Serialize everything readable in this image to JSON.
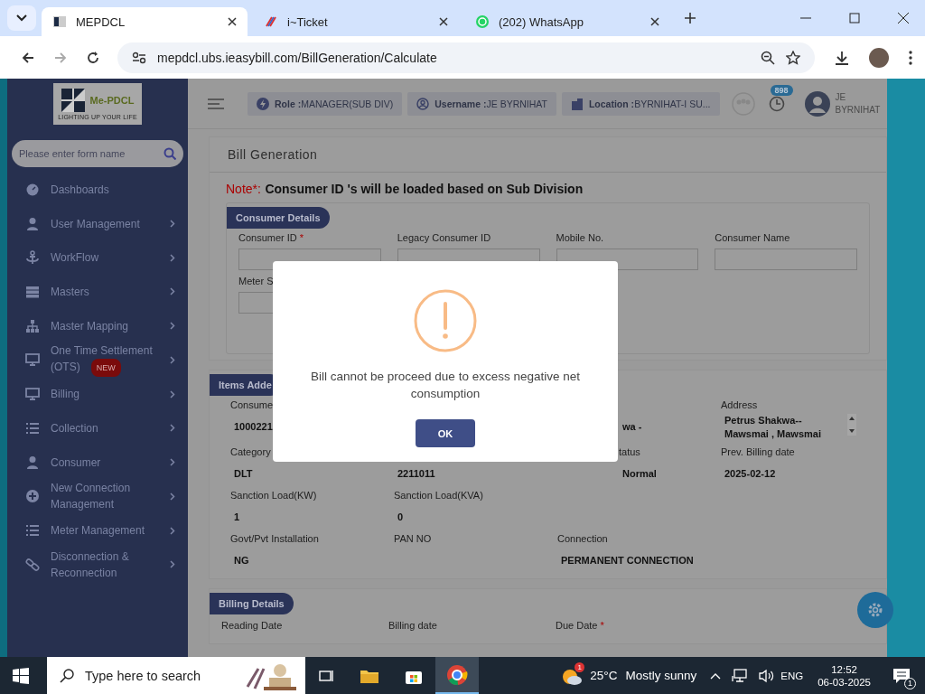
{
  "browser": {
    "tabs": [
      {
        "title": "MEPDCL",
        "selected": true
      },
      {
        "title": "i~Ticket",
        "selected": false
      },
      {
        "title": "(202) WhatsApp",
        "selected": false
      }
    ],
    "url": "mepdcl.ubs.ieasybill.com/BillGeneration/Calculate"
  },
  "sidebar": {
    "logo_text": "Me-PDCL",
    "logo_tagline": "LIGHTING UP YOUR LIFE",
    "search": {
      "placeholder": "Please enter form name"
    },
    "items": [
      {
        "label": "Dashboards",
        "kind": "link"
      },
      {
        "label": "User Management",
        "kind": "submenu"
      },
      {
        "label": "WorkFlow",
        "kind": "submenu"
      },
      {
        "label": "Masters",
        "kind": "submenu"
      },
      {
        "label": "Master Mapping",
        "kind": "submenu"
      },
      {
        "label": "One Time Settlement (OTS)",
        "kind": "submenu",
        "badge": "NEW"
      },
      {
        "label": "Billing",
        "kind": "submenu"
      },
      {
        "label": "Collection",
        "kind": "submenu"
      },
      {
        "label": "Consumer",
        "kind": "submenu"
      },
      {
        "label": "New Connection Management",
        "kind": "submenu"
      },
      {
        "label": "Meter Management",
        "kind": "submenu"
      },
      {
        "label": "Disconnection & Reconnection",
        "kind": "submenu"
      }
    ]
  },
  "header": {
    "chips": [
      {
        "key": "Role :",
        "value": "MANAGER(SUB DIV)"
      },
      {
        "key": "Username :",
        "value": "JE BYRNIHAT"
      },
      {
        "key": "Location :",
        "value": "BYRNIHAT-I SU..."
      }
    ],
    "notification_count": "898",
    "user": "JE BYRNIHAT"
  },
  "page": {
    "title": "Bill Generation",
    "note_label": "Note*:",
    "note_text": "Consumer ID 's will be loaded based on Sub Division",
    "consumer_details": {
      "legend": "Consumer Details",
      "fields": [
        {
          "label": "Consumer ID",
          "required_mark": "*"
        },
        {
          "label": "Legacy Consumer ID"
        },
        {
          "label": "Mobile No."
        },
        {
          "label": "Consumer Name"
        },
        {
          "label": "Meter S"
        }
      ]
    },
    "items_added": {
      "legend": "Items Adde",
      "rows": [
        [
          {
            "label": "Consume",
            "value": "1000221"
          },
          {},
          {
            "value": "wa -",
            "kind": "partial"
          },
          {
            "label": "Address",
            "value": "Petrus Shakwa-- Mawsmai , Mawsmai",
            "kind": "scroll"
          }
        ],
        [
          {
            "label": "Category",
            "value": "DLT"
          },
          {
            "value": "2211011"
          },
          {
            "label": "tatus",
            "value": "Normal",
            "kind": "partial"
          },
          {
            "label": "Prev. Billing date",
            "value": "2025-02-12"
          }
        ],
        [
          {
            "label": "Sanction Load(KW)",
            "value": "1"
          },
          {
            "label": "Sanction Load(KVA)",
            "value": "0"
          },
          {},
          {}
        ],
        [
          {
            "label": "Govt/Pvt Installation",
            "value": "NG"
          },
          {
            "label": "PAN NO"
          },
          {
            "label": "Connection",
            "value": "PERMANENT CONNECTION"
          },
          {}
        ]
      ]
    },
    "billing_details": {
      "legend": "Billing Details",
      "fields": [
        {
          "label": "Reading Date"
        },
        {
          "label": "Billing date"
        },
        {
          "label": "Due Date",
          "required_mark": "*"
        }
      ]
    }
  },
  "dialog": {
    "message": "Bill cannot be proceed due to excess negative net consumption",
    "button": "OK"
  },
  "taskbar": {
    "search": {
      "placeholder": "Type here to search"
    },
    "weather_badge": "1",
    "temperature": "25°C",
    "weather": "Mostly sunny",
    "language": "ENG",
    "time": "12:52",
    "date": "06-03-2025",
    "notifications": "1"
  }
}
